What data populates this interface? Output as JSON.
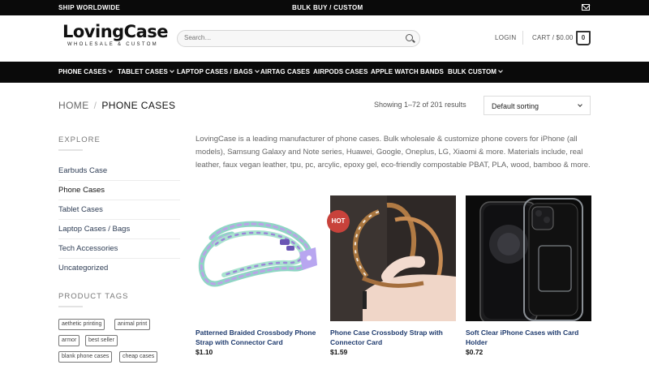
{
  "topbar": {
    "left": "SHIP WORLDWIDE",
    "center": "BULK BUY / CUSTOM",
    "icon": "mail-icon"
  },
  "header": {
    "logo_name": "LovingCase",
    "logo_tagline": "WHOLESALE & CUSTOM",
    "search_placeholder": "Search…",
    "login": "LOGIN",
    "cart": "CART / $0.00",
    "cart_count": "0"
  },
  "nav": {
    "items": [
      {
        "label": "PHONE CASES",
        "dropdown": true
      },
      {
        "label": "TABLET CASES",
        "dropdown": true
      },
      {
        "label": "LAPTOP CASES / BAGS",
        "dropdown": true
      },
      {
        "label": "AIRTAG CASES",
        "dropdown": false
      },
      {
        "label": "AIRPODS CASES",
        "dropdown": false
      },
      {
        "label": "APPLE WATCH BANDS",
        "dropdown": false
      },
      {
        "label": "BULK CUSTOM",
        "dropdown": true
      }
    ]
  },
  "breadcrumb": {
    "home": "HOME",
    "separator": "/",
    "current": "PHONE CASES"
  },
  "results_text": "Showing 1–72 of 201 results",
  "sort": {
    "selected": "Default sorting"
  },
  "sidebar": {
    "explore_title": "EXPLORE",
    "categories": [
      {
        "label": "Earbuds Case",
        "active": false
      },
      {
        "label": "Phone Cases",
        "active": true
      },
      {
        "label": "Tablet Cases",
        "active": false
      },
      {
        "label": "Laptop Cases / Bags",
        "active": false
      },
      {
        "label": "Tech Accessories",
        "active": false
      },
      {
        "label": "Uncategorized",
        "active": false
      }
    ],
    "tags_title": "PRODUCT TAGS",
    "tags": [
      "aethetic printing",
      "animal print",
      "armor",
      "best seller",
      "blank phone cases",
      "cheap cases"
    ]
  },
  "description": "LovingCase is a leading manufacturer of phone cases. Bulk wholesale & customize  phone covers for iPhone (all models), Samsung Galaxy and Note series, Huawei, Google, Oneplus, LG, Xiaomi & more. Materials include, real leather, faux vegan leather, tpu, pc, arcylic, epoxy gel, eco-friendly compostable PBAT, PLA, wood, bamboo & more.",
  "products": [
    {
      "title": "Patterned Braided Crossbody Phone Strap with Connector Card",
      "price": "$1.10",
      "badge": ""
    },
    {
      "title": "Phone Case Crossbody Strap with Connector Card",
      "price": "$1.59",
      "badge": "HOT"
    },
    {
      "title": "Soft Clear iPhone Cases with Card Holder",
      "price": "$0.72",
      "badge": ""
    }
  ],
  "colors": {
    "bar": "#0a0a0a",
    "link": "#1f3b6e",
    "hot_badge": "#c8423b"
  }
}
